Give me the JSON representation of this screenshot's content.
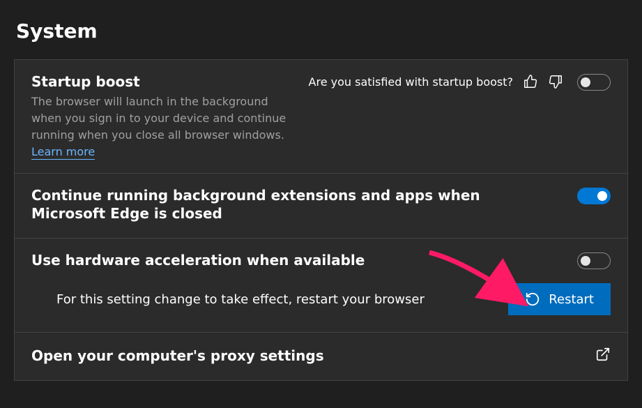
{
  "page_title": "System",
  "startup_boost": {
    "title": "Startup boost",
    "description_pre": "The browser will launch in the background when you sign in to your device and continue running when you close all browser windows. ",
    "learn_more": "Learn more",
    "feedback_prompt": "Are you satisfied with startup boost?",
    "toggle_on": false
  },
  "background_apps": {
    "title": "Continue running background extensions and apps when Microsoft Edge is closed",
    "toggle_on": true
  },
  "hardware_accel": {
    "title": "Use hardware acceleration when available",
    "toggle_on": false,
    "restart_notice": "For this setting change to take effect, restart your browser",
    "restart_label": "Restart"
  },
  "proxy": {
    "title": "Open your computer's proxy settings"
  }
}
